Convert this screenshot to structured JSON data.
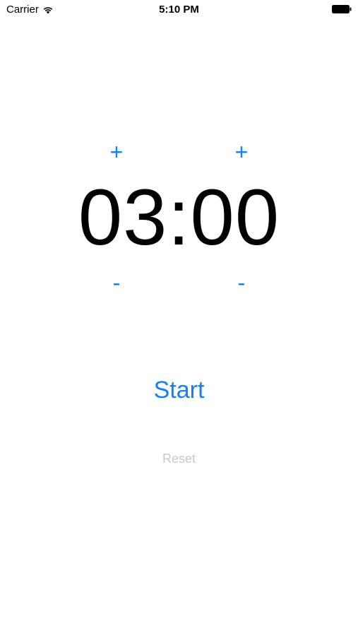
{
  "status_bar": {
    "carrier": "Carrier",
    "time": "5:10 PM",
    "wifi_icon": "wifi-icon",
    "battery_icon": "battery-full-icon"
  },
  "timer": {
    "display": "03:00",
    "minutes_plus": "+",
    "minutes_minus": "-",
    "seconds_plus": "+",
    "seconds_minus": "-"
  },
  "controls": {
    "start_label": "Start",
    "reset_label": "Reset",
    "reset_enabled": false
  },
  "colors": {
    "accent": "#147EFB",
    "muted": "#C8C8CC",
    "text": "#000000",
    "background": "#FFFFFF"
  }
}
